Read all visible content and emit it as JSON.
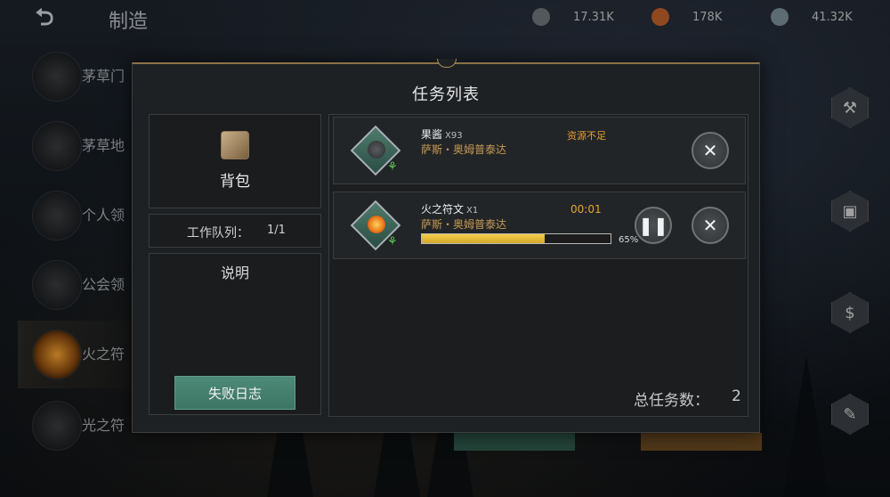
{
  "topbar": {
    "title": "制造",
    "back_icon": "back-arrow-icon",
    "resources": [
      {
        "icon": "stone-resource-icon",
        "value": "17.31K",
        "color": "#6f767c"
      },
      {
        "icon": "copper-resource-icon",
        "value": "178K",
        "color": "#c0602a"
      },
      {
        "icon": "gem-resource-icon",
        "value": "41.32K",
        "color": "#7c8f98"
      }
    ]
  },
  "recipes": [
    {
      "label": "茅草门"
    },
    {
      "label": "茅草地"
    },
    {
      "label": "个人领"
    },
    {
      "label": "公会领"
    },
    {
      "label": "火之符"
    },
    {
      "label": "光之符"
    }
  ],
  "side_menu": [
    {
      "icon": "anvil-icon"
    },
    {
      "icon": "chest-icon"
    },
    {
      "icon": "shop-icon"
    },
    {
      "icon": "scroll-icon"
    }
  ],
  "modal": {
    "title": "任务列表",
    "bag_label": "背包",
    "queue_label": "工作队列：",
    "queue_value": "1/1",
    "desc_label": "说明",
    "fail_log_label": "失败日志",
    "total_label": "总任务数：",
    "total_value": "2"
  },
  "tasks": [
    {
      "name": "果酱",
      "qty": "X93",
      "owner": "萨斯・奥姆普泰达",
      "status": "资源不足",
      "icon": "jam-icon"
    },
    {
      "name": "火之符文",
      "qty": "X1",
      "owner": "萨斯・奥姆普泰达",
      "timer": "00:01",
      "progress": 0.65,
      "progress_label": "65%",
      "icon": "fire-rune-icon"
    }
  ],
  "colors": {
    "accent_gold": "#8a7348",
    "button_teal": "#4d8a78",
    "status_orange": "#e49d33",
    "owner_gold": "#c69a55"
  }
}
